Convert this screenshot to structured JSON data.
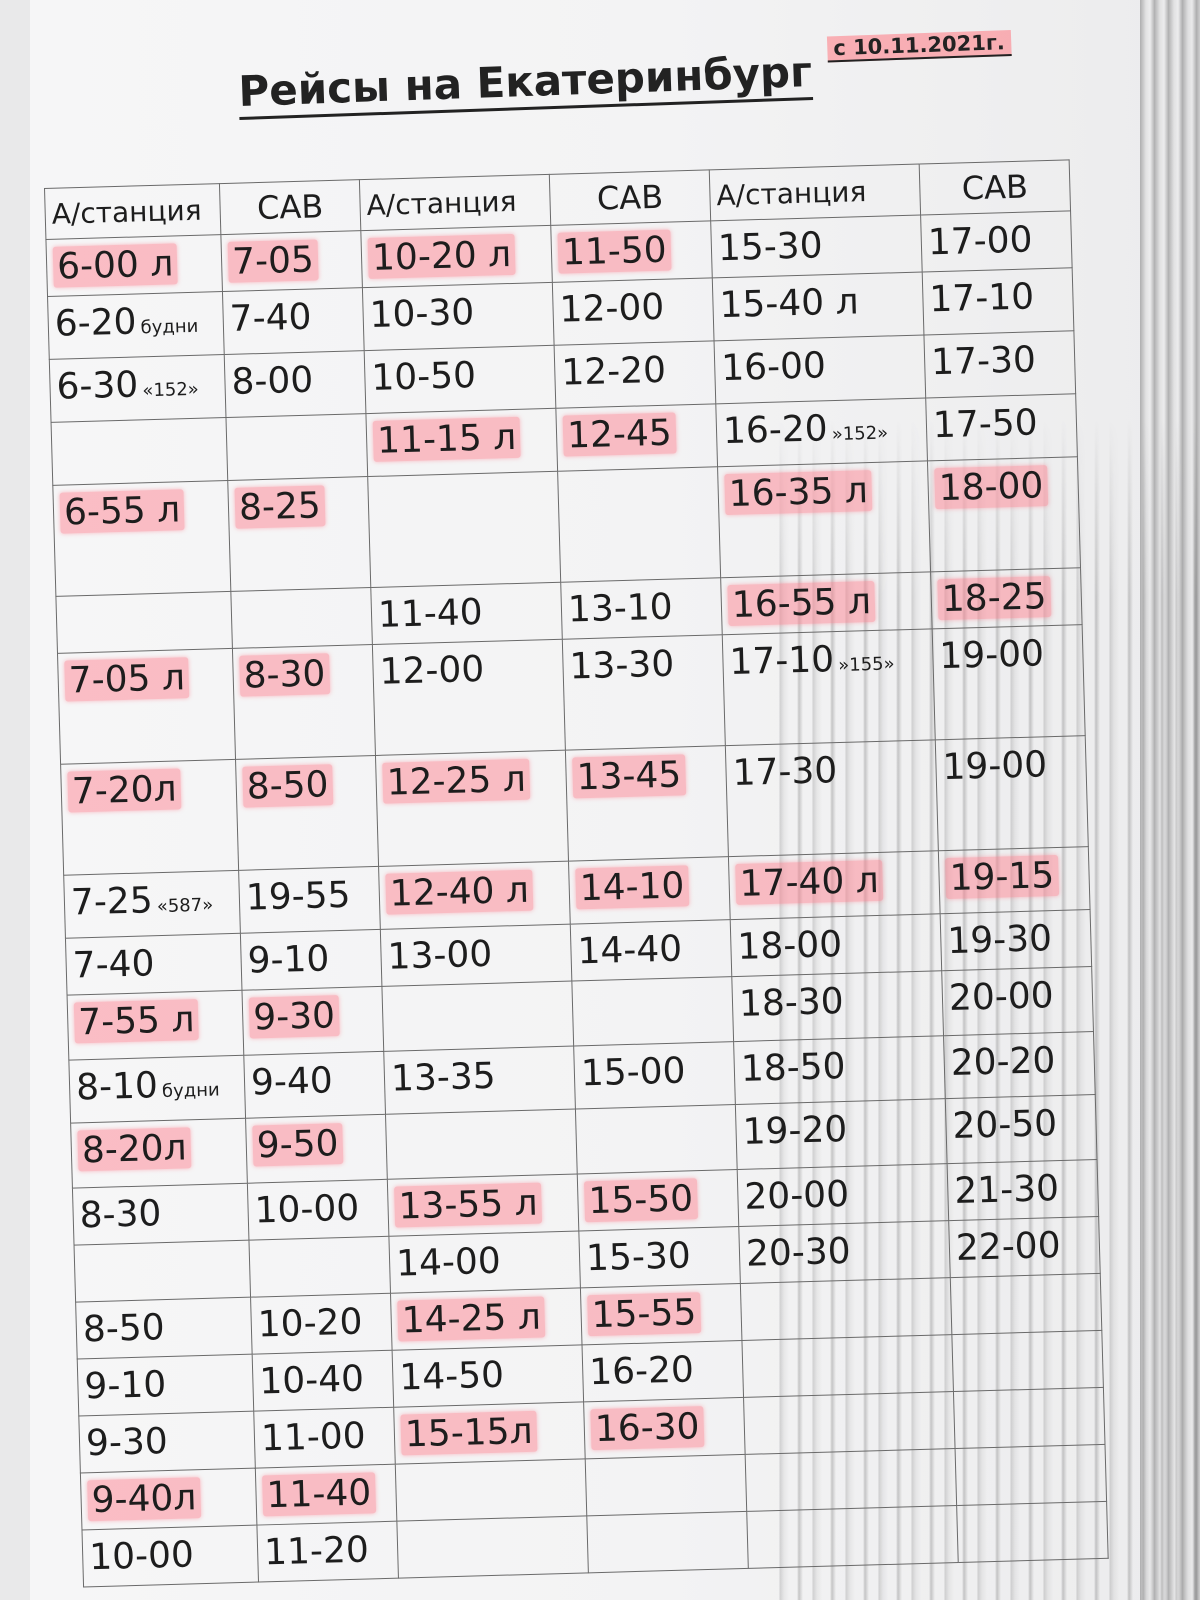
{
  "title": "Рейсы на Екатеринбург",
  "since": "с 10.11.2021г.",
  "headers": [
    "А/станция",
    "САВ",
    "А/станция",
    "САВ",
    "А/станция",
    "САВ"
  ],
  "highlight_color": "#ff7887",
  "rows": [
    [
      {
        "t": "6-00 л",
        "hl": true
      },
      {
        "t": "7-05",
        "hl": true
      },
      {
        "t": "10-20 л",
        "hl": true
      },
      {
        "t": "11-50",
        "hl": true
      },
      {
        "t": "15-30"
      },
      {
        "t": "17-00"
      }
    ],
    [
      {
        "t": "6-20",
        "n": "будни"
      },
      {
        "t": "7-40"
      },
      {
        "t": "10-30"
      },
      {
        "t": "12-00"
      },
      {
        "t": "15-40 л"
      },
      {
        "t": "17-10"
      }
    ],
    [
      {
        "t": "6-30",
        "n": "«152»"
      },
      {
        "t": "8-00"
      },
      {
        "t": "10-50"
      },
      {
        "t": "12-20"
      },
      {
        "t": "16-00"
      },
      {
        "t": "17-30"
      }
    ],
    [
      {
        "t": ""
      },
      {
        "t": ""
      },
      {
        "t": "11-15 л",
        "hl": true
      },
      {
        "t": "12-45",
        "hl": true
      },
      {
        "t": "16-20",
        "n": "»152»"
      },
      {
        "t": "17-50"
      }
    ],
    [
      {
        "t": "6-55 л",
        "hl": true
      },
      {
        "t": "8-25",
        "hl": true
      },
      {
        "t": ""
      },
      {
        "t": ""
      },
      {
        "t": "16-35 л",
        "hl": true
      },
      {
        "t": "18-00",
        "hl": true
      }
    ],
    [
      {
        "t": ""
      },
      {
        "t": ""
      },
      {
        "t": "11-40"
      },
      {
        "t": "13-10"
      },
      {
        "t": "16-55 л",
        "hl": true
      },
      {
        "t": "18-25",
        "hl": true
      }
    ],
    [
      {
        "t": "7-05 л",
        "hl": true
      },
      {
        "t": "8-30",
        "hl": true
      },
      {
        "t": "12-00"
      },
      {
        "t": "13-30"
      },
      {
        "t": "17-10",
        "n": "»155»"
      },
      {
        "t": "19-00"
      }
    ],
    [
      {
        "t": "7-20л",
        "hl": true
      },
      {
        "t": "8-50",
        "hl": true
      },
      {
        "t": "12-25 л",
        "hl": true
      },
      {
        "t": "13-45",
        "hl": true
      },
      {
        "t": "17-30"
      },
      {
        "t": "19-00"
      }
    ],
    [
      {
        "t": "7-25",
        "n": "«587»"
      },
      {
        "t": "19-55"
      },
      {
        "t": "12-40 л",
        "hl": true
      },
      {
        "t": "14-10",
        "hl": true
      },
      {
        "t": "17-40 л",
        "hl": true
      },
      {
        "t": "19-15",
        "hl": true
      }
    ],
    [
      {
        "t": "7-40"
      },
      {
        "t": "9-10"
      },
      {
        "t": "13-00"
      },
      {
        "t": "14-40"
      },
      {
        "t": "18-00"
      },
      {
        "t": "19-30"
      }
    ],
    [
      {
        "t": "7-55 л",
        "hl": true
      },
      {
        "t": "9-30",
        "hl": true
      },
      {
        "t": ""
      },
      {
        "t": ""
      },
      {
        "t": "18-30"
      },
      {
        "t": "20-00"
      }
    ],
    [
      {
        "t": "8-10",
        "n": "будни"
      },
      {
        "t": "9-40"
      },
      {
        "t": "13-35"
      },
      {
        "t": "15-00"
      },
      {
        "t": "18-50"
      },
      {
        "t": "20-20"
      }
    ],
    [
      {
        "t": "8-20л",
        "hl": true
      },
      {
        "t": "9-50",
        "hl": true
      },
      {
        "t": ""
      },
      {
        "t": ""
      },
      {
        "t": "19-20"
      },
      {
        "t": "20-50"
      }
    ],
    [
      {
        "t": "8-30"
      },
      {
        "t": "10-00"
      },
      {
        "t": "13-55 л",
        "hl": true
      },
      {
        "t": "15-50",
        "hl": true
      },
      {
        "t": "20-00"
      },
      {
        "t": "21-30"
      }
    ],
    [
      {
        "t": ""
      },
      {
        "t": ""
      },
      {
        "t": "14-00"
      },
      {
        "t": "15-30"
      },
      {
        "t": "20-30"
      },
      {
        "t": "22-00"
      }
    ],
    [
      {
        "t": "8-50"
      },
      {
        "t": "10-20"
      },
      {
        "t": "14-25 л",
        "hl": true
      },
      {
        "t": "15-55",
        "hl": true
      },
      {
        "t": ""
      },
      {
        "t": ""
      }
    ],
    [
      {
        "t": "9-10"
      },
      {
        "t": "10-40"
      },
      {
        "t": "14-50"
      },
      {
        "t": "16-20"
      },
      {
        "t": ""
      },
      {
        "t": ""
      }
    ],
    [
      {
        "t": "9-30"
      },
      {
        "t": "11-00"
      },
      {
        "t": "15-15л",
        "hl": true
      },
      {
        "t": "16-30",
        "hl": true
      },
      {
        "t": ""
      },
      {
        "t": ""
      }
    ],
    [
      {
        "t": "9-40л",
        "hl": true
      },
      {
        "t": "11-40",
        "hl": true
      },
      {
        "t": ""
      },
      {
        "t": ""
      },
      {
        "t": ""
      },
      {
        "t": ""
      }
    ],
    [
      {
        "t": "10-00"
      },
      {
        "t": "11-20"
      },
      {
        "t": ""
      },
      {
        "t": ""
      },
      {
        "t": ""
      },
      {
        "t": ""
      }
    ]
  ]
}
